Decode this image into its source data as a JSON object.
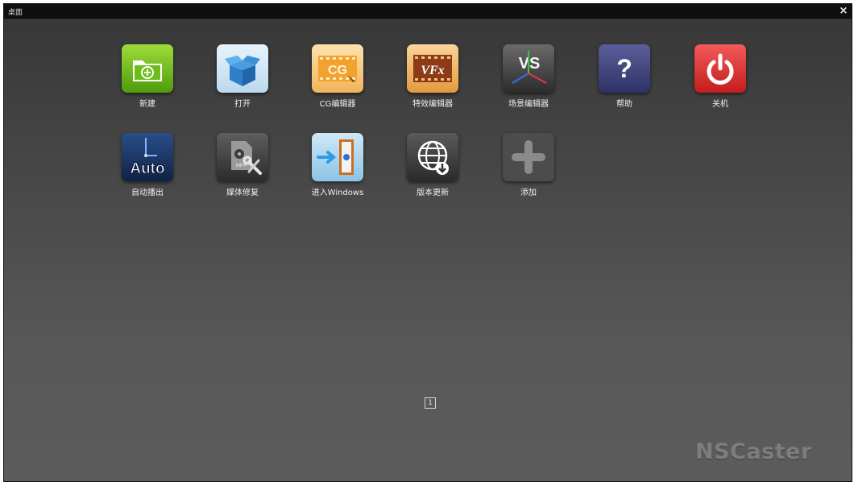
{
  "window": {
    "title": "桌面",
    "close_label": "×"
  },
  "desktop": {
    "row1": [
      {
        "key": "new",
        "label": "新建",
        "icon": "new-folder-icon"
      },
      {
        "key": "open",
        "label": "打开",
        "icon": "open-box-icon"
      },
      {
        "key": "cg",
        "label": "CG编辑器",
        "icon": "cg-editor-icon",
        "icon_text": "CG"
      },
      {
        "key": "vfx",
        "label": "特效编辑器",
        "icon": "vfx-editor-icon",
        "icon_text": "VFx"
      },
      {
        "key": "scene",
        "label": "场景编辑器",
        "icon": "scene-editor-icon",
        "icon_text": "VS"
      },
      {
        "key": "help",
        "label": "帮助",
        "icon": "help-icon",
        "icon_text": "?"
      },
      {
        "key": "shutdown",
        "label": "关机",
        "icon": "power-icon"
      }
    ],
    "row2": [
      {
        "key": "auto",
        "label": "自动播出",
        "icon": "auto-play-icon",
        "icon_text": "Auto"
      },
      {
        "key": "repair",
        "label": "媒体修复",
        "icon": "media-repair-icon",
        "icon_text": "MP4"
      },
      {
        "key": "windows",
        "label": "进入Windows",
        "icon": "enter-windows-icon"
      },
      {
        "key": "update",
        "label": "版本更新",
        "icon": "version-update-icon"
      },
      {
        "key": "add",
        "label": "添加",
        "icon": "add-icon"
      }
    ]
  },
  "pager": {
    "current": "1"
  },
  "brand": {
    "name": "NSCaster"
  },
  "colors": {
    "titlebar": "#0f0f0f",
    "desktop_top": "#363636",
    "desktop_bottom": "#5c5c5c",
    "label": "#f0f0f0",
    "brand": "#7d7d7d"
  }
}
